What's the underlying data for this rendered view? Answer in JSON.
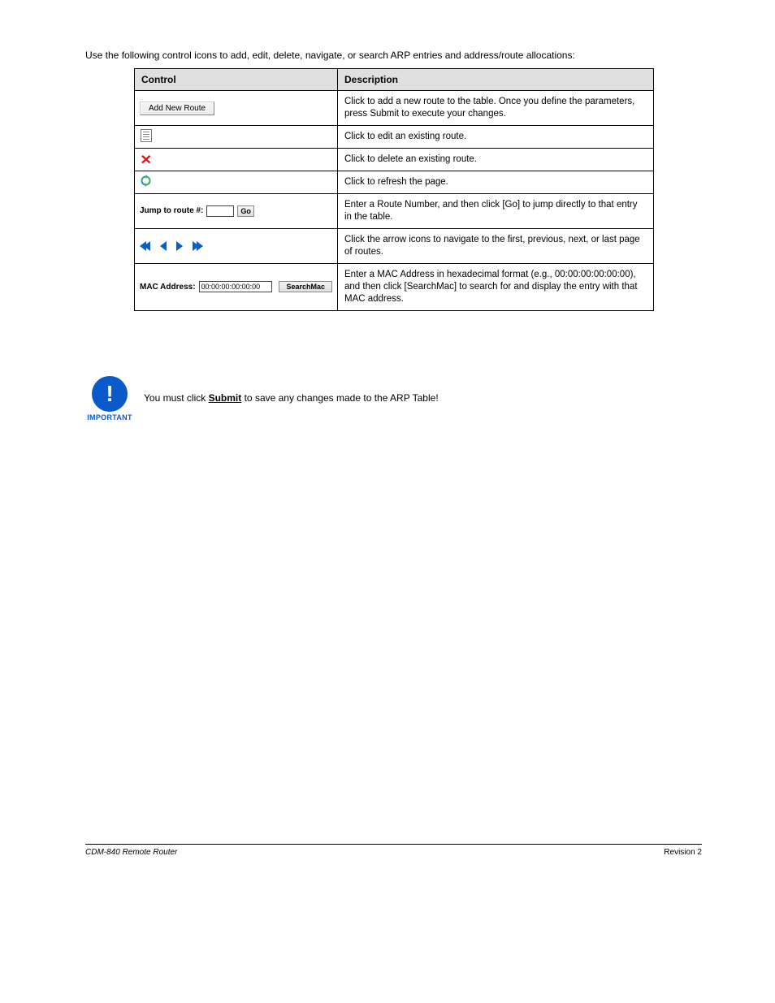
{
  "intro": "Use the following control icons to add, edit, delete, navigate, or search ARP entries and address/route allocations:",
  "table": {
    "headers": {
      "control": "Control",
      "description": "Description"
    },
    "rows": [
      {
        "control": {
          "kind": "button",
          "label": "Add New Route"
        },
        "desc": "Click to add a new route to the table. Once you define the parameters, press Submit to execute your changes."
      },
      {
        "control": {
          "kind": "edit-icon"
        },
        "desc": "Click to edit an existing route."
      },
      {
        "control": {
          "kind": "x-icon"
        },
        "desc": "Click to delete an existing route."
      },
      {
        "control": {
          "kind": "refresh-icon"
        },
        "desc": "Click to refresh the page."
      },
      {
        "control": {
          "kind": "jump",
          "label": "Jump to route #:",
          "go": "Go"
        },
        "desc": "Enter a Route Number, and then click [Go] to jump directly to that entry in the table."
      },
      {
        "control": {
          "kind": "nav",
          "counter": ""
        },
        "desc": "Click the arrow icons to navigate to the first, previous, next, or last page of routes."
      },
      {
        "control": {
          "kind": "mac",
          "label": "MAC Address:",
          "value": "00:00:00:00:00:00",
          "search": "SearchMac"
        },
        "desc": "Enter a MAC Address in hexadecimal format (e.g., 00:00:00:00:00:00), and then click [SearchMac] to search for and display the entry with that MAC address."
      }
    ]
  },
  "important": {
    "label": "IMPORTANT",
    "text_before": "You must click ",
    "text_submit": "Submit",
    "text_after": " to save any changes made to the ARP Table!"
  },
  "footer": {
    "left": "CDM-840 Remote Router",
    "right": "Revision 2"
  }
}
